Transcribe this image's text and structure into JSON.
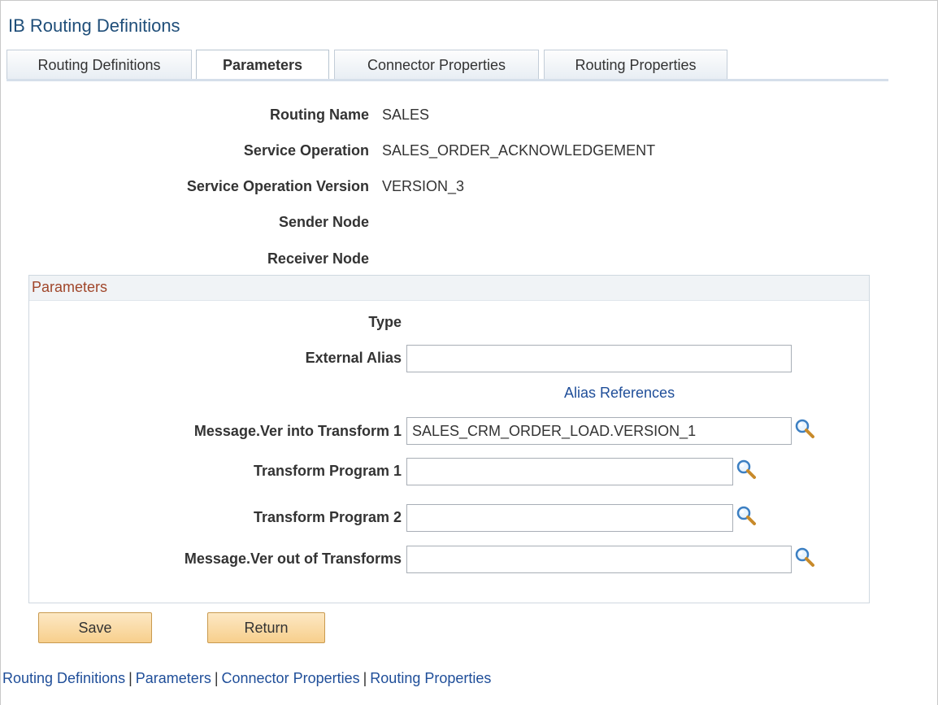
{
  "header": {
    "title": "IB Routing Definitions"
  },
  "tabs": [
    {
      "label": "Routing Definitions",
      "active": false
    },
    {
      "label": "Parameters",
      "active": true
    },
    {
      "label": "Connector Properties",
      "active": false
    },
    {
      "label": "Routing Properties",
      "active": false
    }
  ],
  "details": {
    "routing_name_label": "Routing Name",
    "routing_name_value": "SALES",
    "service_operation_label": "Service Operation",
    "service_operation_value": "SALES_ORDER_ACKNOWLEDGEMENT",
    "service_operation_version_label": "Service Operation Version",
    "service_operation_version_value": "VERSION_3",
    "sender_node_label": "Sender Node",
    "receiver_node_label": "Receiver Node"
  },
  "parameters": {
    "title": "Parameters",
    "type_label": "Type",
    "external_alias_label": "External Alias",
    "external_alias_value": "",
    "alias_references_link": "Alias References",
    "message_ver_into_label": "Message.Ver into Transform 1",
    "message_ver_into_value": "SALES_CRM_ORDER_LOAD.VERSION_1",
    "transform_program_1_label": "Transform Program 1",
    "transform_program_1_value": "",
    "transform_program_2_label": "Transform Program 2",
    "transform_program_2_value": "",
    "message_ver_out_label": "Message.Ver out of Transforms",
    "message_ver_out_value": ""
  },
  "buttons": {
    "save": "Save",
    "return": "Return"
  },
  "footer": {
    "links": [
      "Routing Definitions",
      "Parameters",
      "Connector Properties",
      "Routing Properties"
    ],
    "separator": "|"
  },
  "icons": {
    "lookup": "magnifying-glass-icon"
  },
  "colors": {
    "title": "#1f4e79",
    "link": "#1f4e99",
    "group_title": "#a0462a",
    "button_fill": "#f7cf8c"
  }
}
